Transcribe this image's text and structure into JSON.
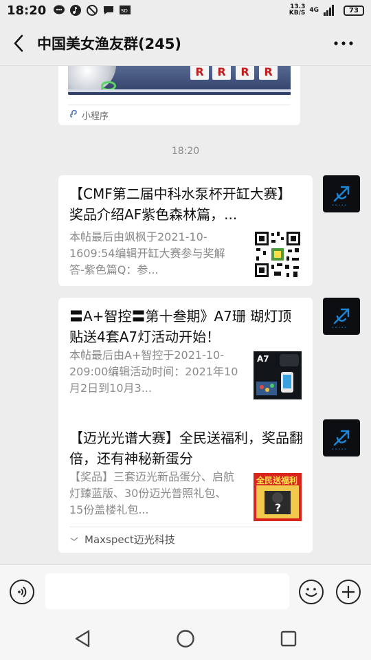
{
  "status_bar": {
    "time": "18:20",
    "net_speed_value": "13.3",
    "net_speed_unit": "KB/S",
    "network": "4G",
    "battery": "73",
    "icons": [
      "chat-bubble-icon",
      "music-note-icon",
      "do-not-disturb-icon",
      "message-icon",
      "sd-card-icon",
      "wifi-icon",
      "signal-icon"
    ]
  },
  "header": {
    "title": "中国美女渔友群(245)",
    "back_icon": "back-arrow-icon",
    "more_icon": "more-dots-icon"
  },
  "chat": {
    "mini_program": {
      "label": "小程序",
      "key_letters": [
        "R",
        "R",
        "R",
        "R"
      ]
    },
    "timestamp": "18:20",
    "messages": [
      {
        "title": "【CMF第二届中科水泵杯开缸大赛】奖品介绍AF紫色森林篇，...",
        "desc": "本帖最后由飒枫于2021-10-1609:54编辑开缸大赛参与奖解答-紫色篇Q：参...",
        "thumb": "qr-code"
      },
      {
        "title": "〓A+智控〓第十叁期》A7珊 瑚灯顶贴送4套A7灯活动开始！",
        "desc": "本帖最后由A+智控于2021-10-209:00编辑活动时间：2021年10月2日到10月3...",
        "thumb": "a7-product",
        "thumb_label": "A7"
      },
      {
        "title": "【迈光光谱大赛】全民送福利，奖品翻倍，还有神秘新蛋分",
        "desc": "【奖品】三套迈光新品蛋分、启航灯臻蓝版、30份迈光普照礼包、15份盖楼礼包...",
        "thumb": "giveaway-poster",
        "thumb_label": "全民送福利",
        "source": "Maxspect迈光科技"
      }
    ]
  },
  "colors": {
    "background": "#ededed",
    "card": "#ffffff",
    "avatar_bg": "#0c0e12",
    "avatar_accent": "#1d86d6"
  }
}
